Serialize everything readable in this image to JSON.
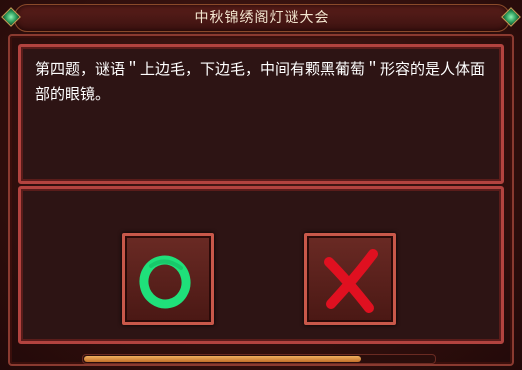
{
  "dialog": {
    "title": "中秋锦绣阁灯谜大会",
    "question": "第四题，谜语＂上边毛，下边毛，中间有颗黑葡萄＂形容的是人体面部的眼镜。",
    "answers": {
      "true_icon": "circle-o-icon",
      "false_icon": "cross-x-icon",
      "true_color": "#1fe07a",
      "false_color": "#e01020"
    },
    "timer_progress": 0.79
  },
  "colors": {
    "frame_accent": "#b2433f",
    "panel_bg": "#2d1414",
    "progress_fill": "#e0963c"
  }
}
